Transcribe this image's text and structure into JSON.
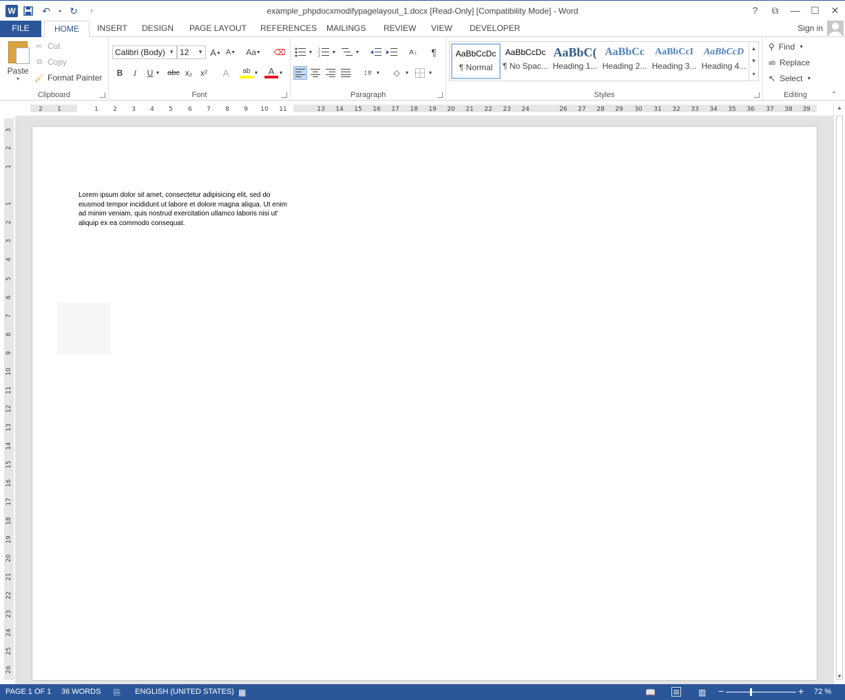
{
  "window": {
    "title": "example_phpdocxmodifypagelayout_1.docx [Read-Only] [Compatibility Mode] - Word",
    "help": "?",
    "restore_ribbon": "⧉",
    "minimize": "—",
    "maximize": "☐",
    "close": "✕"
  },
  "qat": {
    "logo": "W",
    "save": "💾",
    "undo": "↶",
    "undo_arrow": "▾",
    "redo": "↻",
    "customize": "⩡"
  },
  "tabs": [
    "FILE",
    "HOME",
    "INSERT",
    "DESIGN",
    "PAGE LAYOUT",
    "REFERENCES",
    "MAILINGS",
    "REVIEW",
    "VIEW",
    "DEVELOPER"
  ],
  "signin": "Sign in",
  "clipboard": {
    "paste": "Paste",
    "cut": "Cut",
    "copy": "Copy",
    "format_painter": "Format Painter",
    "label": "Clipboard"
  },
  "font": {
    "family": "Calibri (Body)",
    "size": "12",
    "label": "Font",
    "grow": "A",
    "shrink": "A",
    "case": "Aa",
    "bold": "B",
    "italic": "I",
    "underline": "U",
    "strike": "abc",
    "subscript": "x₂",
    "superscript": "x²",
    "text_effects": "A",
    "highlight": "ab",
    "font_color": "A"
  },
  "paragraph": {
    "label": "Paragraph",
    "pilcrow": "¶"
  },
  "styles": {
    "label": "Styles",
    "items": [
      {
        "sample": "AaBbCcDc",
        "name": "¶ Normal"
      },
      {
        "sample": "AaBbCcDc",
        "name": "¶ No Spac..."
      },
      {
        "sample": "AaBbC(",
        "name": "Heading 1..."
      },
      {
        "sample": "AaBbCc",
        "name": "Heading 2..."
      },
      {
        "sample": "AaBbCcI",
        "name": "Heading 3..."
      },
      {
        "sample": "AaBbCcD",
        "name": "Heading 4..."
      }
    ]
  },
  "editing": {
    "find": "Find",
    "replace": "Replace",
    "select": "Select",
    "label": "Editing"
  },
  "ruler": {
    "tab_selector": "L",
    "h_ticks": [
      "2",
      "1",
      "1",
      "2",
      "3",
      "4",
      "5",
      "6",
      "7",
      "8",
      "9",
      "10",
      "11",
      "13",
      "14",
      "15",
      "16",
      "17",
      "18",
      "19",
      "20",
      "21",
      "22",
      "23",
      "24",
      "26",
      "27",
      "28",
      "29",
      "30",
      "31",
      "32",
      "33",
      "34",
      "35",
      "36",
      "37",
      "38",
      "39"
    ],
    "v_ticks": [
      "3",
      "2",
      "1",
      "1",
      "2",
      "3",
      "4",
      "5",
      "6",
      "7",
      "8",
      "9",
      "10",
      "11",
      "12",
      "13",
      "14",
      "15",
      "16",
      "17",
      "18",
      "19",
      "20",
      "21",
      "22",
      "23",
      "24",
      "25",
      "26"
    ]
  },
  "document": {
    "paragraph": "Lorem ipsum dolor sit amet, consectetur adipisicing elit, sed do eiusmod tempor incididunt ut labore et dolore magna aliqua. Ut enim ad minim veniam, quis nostrud exercitation ullamco laboris nisi ut' aliquip ex ea commodo consequat."
  },
  "status": {
    "page": "PAGE 1 OF 1",
    "words": "36 WORDS",
    "language": "ENGLISH (UNITED STATES)",
    "zoom": "72 %",
    "zoom_minus": "−",
    "zoom_plus": "+"
  },
  "colors": {
    "accent": "#2b579a",
    "highlight": "#ffff00",
    "font_color": "#e81123"
  }
}
